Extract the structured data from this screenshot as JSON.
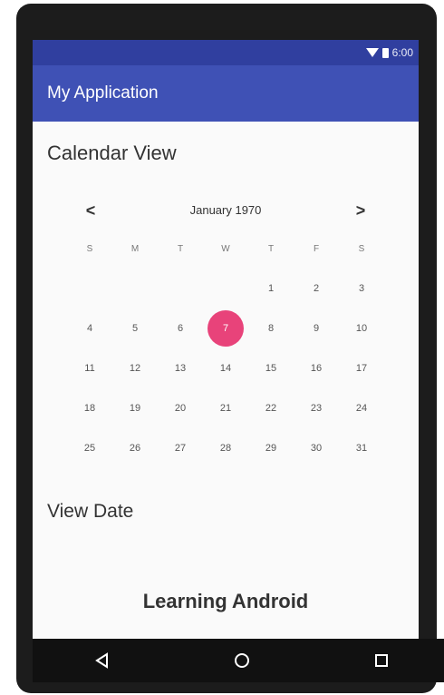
{
  "status_bar": {
    "time": "6:00"
  },
  "app_bar": {
    "title": "My Application"
  },
  "heading": "Calendar View",
  "calendar": {
    "month_label": "January 1970",
    "prev": "<",
    "next": ">",
    "weekdays": [
      "S",
      "M",
      "T",
      "W",
      "T",
      "F",
      "S"
    ],
    "weeks": [
      [
        "",
        "",
        "",
        "",
        "1",
        "2",
        "3"
      ],
      [
        "4",
        "5",
        "6",
        "7",
        "8",
        "9",
        "10"
      ],
      [
        "11",
        "12",
        "13",
        "14",
        "15",
        "16",
        "17"
      ],
      [
        "18",
        "19",
        "20",
        "21",
        "22",
        "23",
        "24"
      ],
      [
        "25",
        "26",
        "27",
        "28",
        "29",
        "30",
        "31"
      ]
    ],
    "selected_day": "7",
    "accent_color": "#e8437a"
  },
  "view_date_label": "View Date",
  "footer_text": "Learning Android",
  "nav": {
    "back_icon": "back-icon",
    "home_icon": "home-icon",
    "recents_icon": "recents-icon"
  }
}
